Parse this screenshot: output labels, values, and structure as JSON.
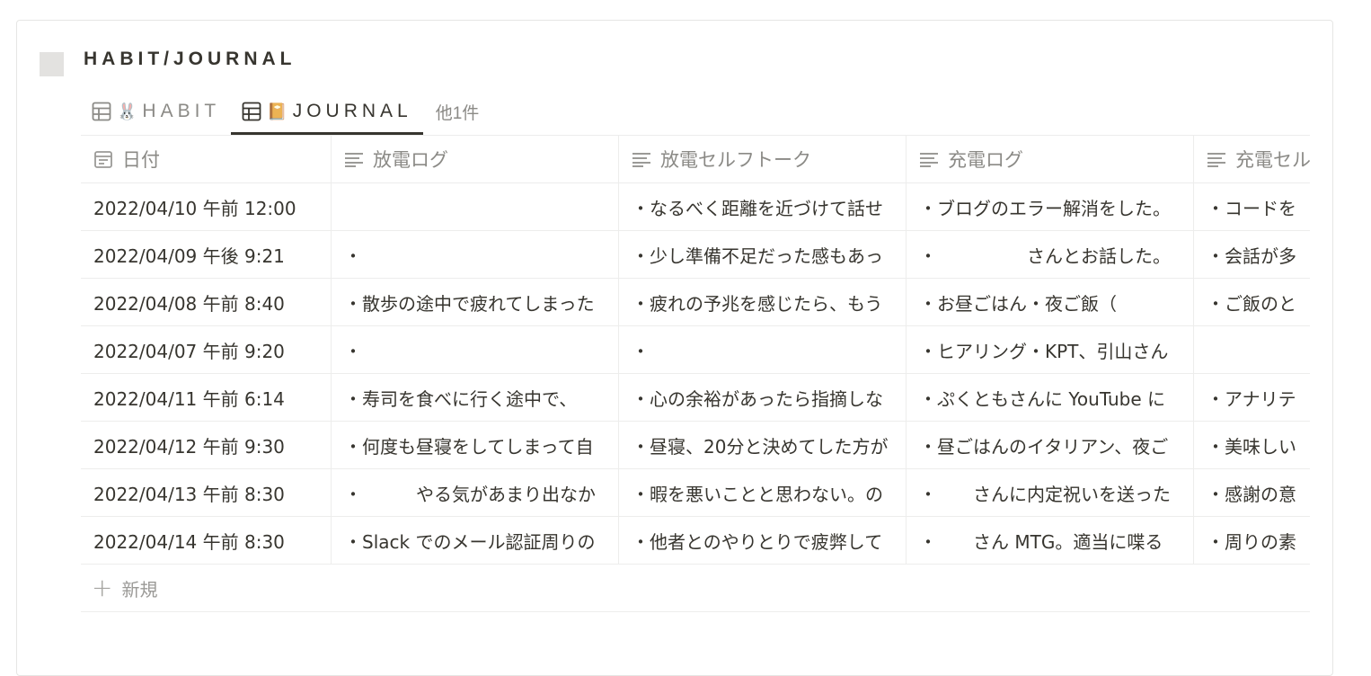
{
  "block": {
    "title": "HABIT/JOURNAL"
  },
  "tabs": [
    {
      "icon": "table-icon",
      "emoji": "🐰",
      "label": "HABIT",
      "active": false
    },
    {
      "icon": "table-icon",
      "emoji": "📔",
      "label": "JOURNAL",
      "active": true
    }
  ],
  "tabs_more": "他1件",
  "columns": [
    {
      "icon": "calendar-icon",
      "label": "日付"
    },
    {
      "icon": "text-lines-icon",
      "label": "放電ログ"
    },
    {
      "icon": "text-lines-icon",
      "label": "放電セルフトーク"
    },
    {
      "icon": "text-lines-icon",
      "label": "充電ログ"
    },
    {
      "icon": "text-lines-icon",
      "label": "充電セル"
    }
  ],
  "rows": [
    [
      "2022/04/10 午前 12:00",
      "",
      "・なるべく距離を近づけて話せ",
      "・ブログのエラー解消をした。",
      "・コードを"
    ],
    [
      "2022/04/09 午後 9:21",
      "・",
      "・少し準備不足だった感もあっ",
      "・　　　　　さんとお話した。",
      "・会話が多"
    ],
    [
      "2022/04/08 午前 8:40",
      "・散歩の途中で疲れてしまった",
      "・疲れの予兆を感じたら、もう",
      "・お昼ごはん・夜ご飯（",
      "・ご飯のと"
    ],
    [
      "2022/04/07 午前 9:20",
      "・",
      "・",
      "・ヒアリング・KPT、引山さん",
      ""
    ],
    [
      "2022/04/11 午前 6:14",
      "・寿司を食べに行く途中で、",
      "・心の余裕があったら指摘しな",
      "・ぷくともさんに YouTube に",
      "・アナリテ"
    ],
    [
      "2022/04/12 午前 9:30",
      "・何度も昼寝をしてしまって自",
      "・昼寝、20分と決めてした方が",
      "・昼ごはんのイタリアン、夜ご",
      "・美味しい"
    ],
    [
      "2022/04/13 午前 8:30",
      "・　　　やる気があまり出なか",
      "・暇を悪いことと思わない。の",
      "・　　さんに内定祝いを送った",
      "・感謝の意"
    ],
    [
      "2022/04/14 午前 8:30",
      "・Slack でのメール認証周りの",
      "・他者とのやりとりで疲弊して",
      "・　　さん MTG。適当に喋る",
      "・周りの素"
    ]
  ],
  "new_row_label": "新規",
  "colors": {
    "text": "#37352f",
    "muted": "#8b8a86",
    "border": "#ededec",
    "icon_block": "#e3e2e0"
  }
}
